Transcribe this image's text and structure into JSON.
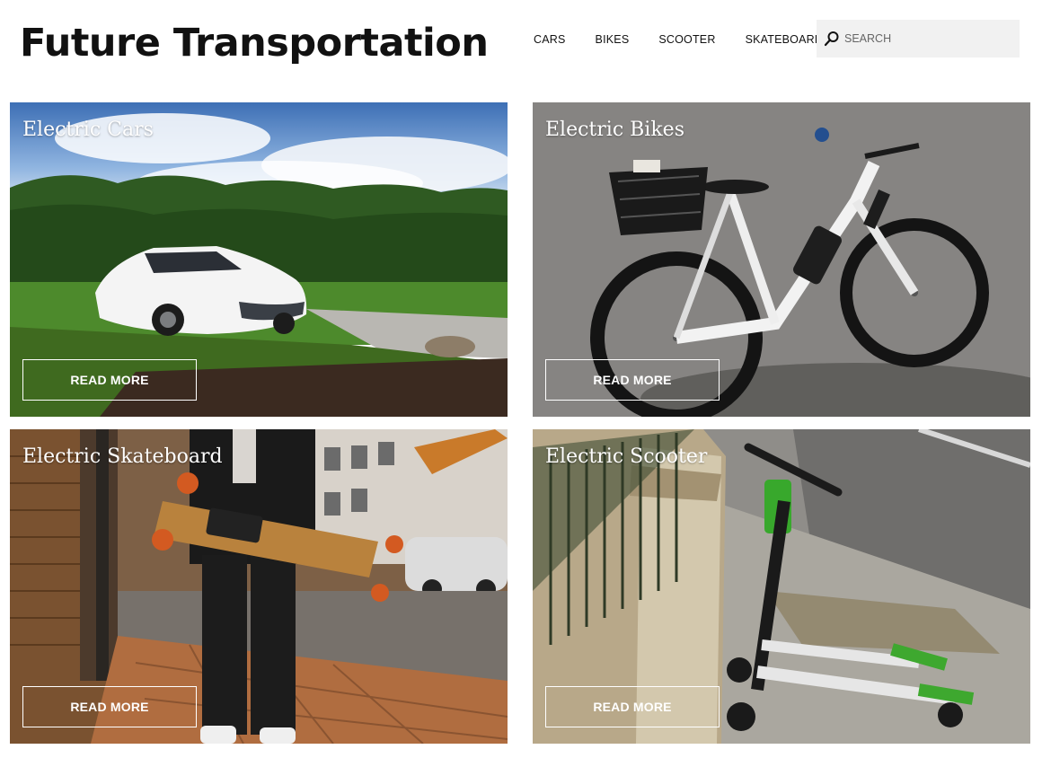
{
  "site": {
    "title": "Future Transportation"
  },
  "nav": {
    "items": [
      {
        "label": "CARS"
      },
      {
        "label": "BIKES"
      },
      {
        "label": "SCOOTER"
      },
      {
        "label": "SKATEBOARD"
      }
    ]
  },
  "search": {
    "placeholder": "SEARCH",
    "value": ""
  },
  "cards": [
    {
      "title": "Electric Cars",
      "button": "READ MORE"
    },
    {
      "title": "Electric Bikes",
      "button": "READ MORE"
    },
    {
      "title": "Electric Skateboard",
      "button": "READ MORE"
    },
    {
      "title": "Electric Scooter",
      "button": "READ MORE"
    }
  ],
  "icons": {
    "search": "search-icon"
  }
}
